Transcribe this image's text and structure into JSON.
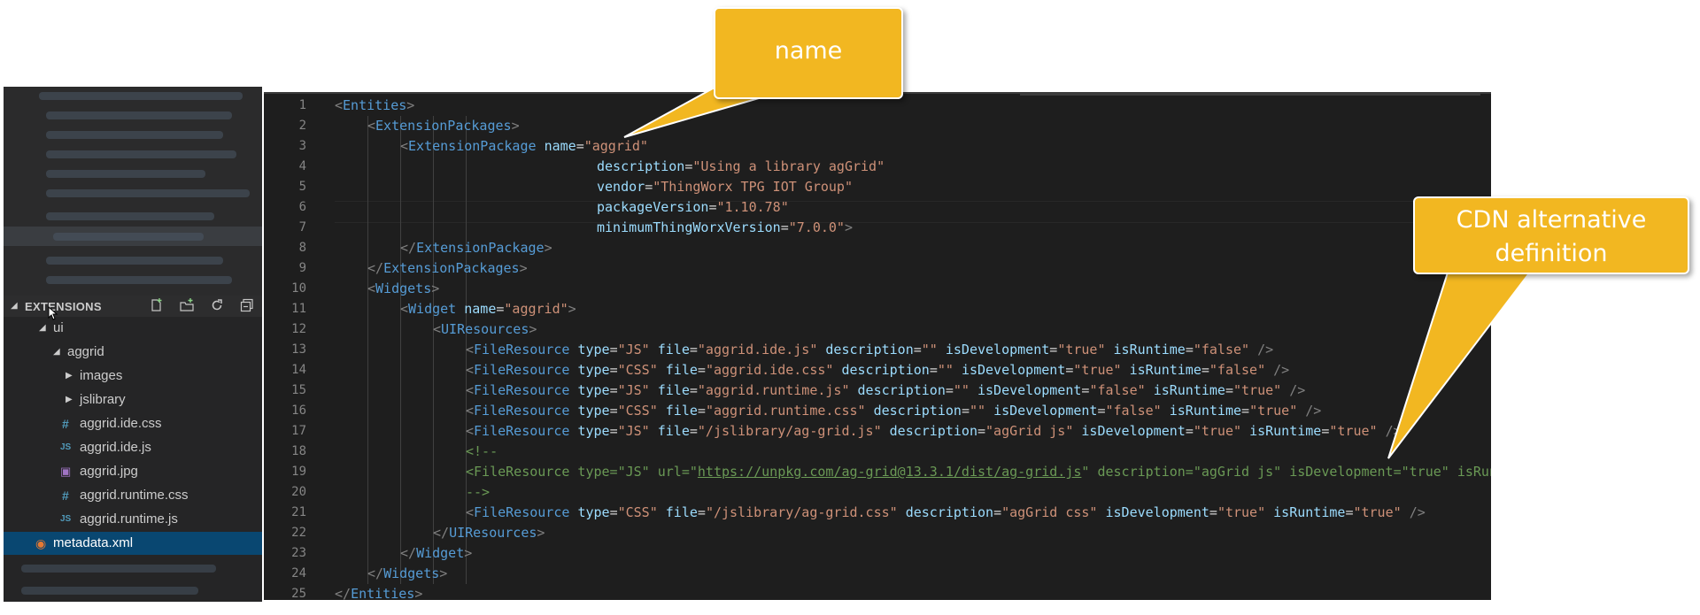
{
  "sidebar": {
    "section_title": "EXTENSIONS",
    "tree": [
      {
        "label": "ui",
        "icon": "chevron-down-icon"
      },
      {
        "label": "aggrid",
        "icon": "chevron-down-icon"
      },
      {
        "label": "images",
        "icon": "chevron-right-icon"
      },
      {
        "label": "jslibrary",
        "icon": "chevron-right-icon"
      },
      {
        "label": "aggrid.ide.css",
        "icon": "css-file-icon"
      },
      {
        "label": "aggrid.ide.js",
        "icon": "js-file-icon"
      },
      {
        "label": "aggrid.jpg",
        "icon": "image-file-icon"
      },
      {
        "label": "aggrid.runtime.css",
        "icon": "css-file-icon"
      },
      {
        "label": "aggrid.runtime.js",
        "icon": "js-file-icon"
      },
      {
        "label": "metadata.xml",
        "icon": "xml-rss-icon",
        "selected": true
      }
    ],
    "icon_glyphs": {
      "css": "#",
      "js": "JS",
      "img": "▣",
      "rss": "◉"
    }
  },
  "toolbar": {
    "icons": [
      "new-file-icon",
      "new-folder-icon",
      "refresh-icon",
      "collapse-all-icon"
    ]
  },
  "editor": {
    "line_numbers": [
      "1",
      "2",
      "3",
      "4",
      "5",
      "6",
      "7",
      "8",
      "9",
      "10",
      "11",
      "12",
      "13",
      "14",
      "15",
      "16",
      "17",
      "18",
      "19",
      "20",
      "21",
      "22",
      "23",
      "24",
      "25"
    ],
    "lines": [
      [
        [
          "b",
          "<"
        ],
        [
          "t",
          "Entities"
        ],
        [
          "b",
          ">"
        ]
      ],
      [
        [
          "b",
          "<"
        ],
        [
          "t",
          "ExtensionPackages"
        ],
        [
          "b",
          ">"
        ]
      ],
      [
        [
          "b",
          "<"
        ],
        [
          "t",
          "ExtensionPackage "
        ],
        [
          "a",
          "name"
        ],
        [
          "e",
          "="
        ],
        [
          "v",
          "\"aggrid\""
        ]
      ],
      [
        [
          "a",
          "description"
        ],
        [
          "e",
          "="
        ],
        [
          "v",
          "\"Using a library agGrid\""
        ]
      ],
      [
        [
          "a",
          "vendor"
        ],
        [
          "e",
          "="
        ],
        [
          "v",
          "\"ThingWorx TPG IOT Group\""
        ]
      ],
      [
        [
          "a",
          "packageVersion"
        ],
        [
          "e",
          "="
        ],
        [
          "v",
          "\"1.10.78\""
        ]
      ],
      [
        [
          "a",
          "minimumThingWorxVersion"
        ],
        [
          "e",
          "="
        ],
        [
          "v",
          "\"7.0.0\""
        ],
        [
          "b",
          ">"
        ]
      ],
      [
        [
          "b",
          "</"
        ],
        [
          "t",
          "ExtensionPackage"
        ],
        [
          "b",
          ">"
        ]
      ],
      [
        [
          "b",
          "</"
        ],
        [
          "t",
          "ExtensionPackages"
        ],
        [
          "b",
          ">"
        ]
      ],
      [
        [
          "b",
          "<"
        ],
        [
          "t",
          "Widgets"
        ],
        [
          "b",
          ">"
        ]
      ],
      [
        [
          "b",
          "<"
        ],
        [
          "t",
          "Widget "
        ],
        [
          "a",
          "name"
        ],
        [
          "e",
          "="
        ],
        [
          "v",
          "\"aggrid\""
        ],
        [
          "b",
          ">"
        ]
      ],
      [
        [
          "b",
          "<"
        ],
        [
          "t",
          "UIResources"
        ],
        [
          "b",
          ">"
        ]
      ],
      [
        [
          "b",
          "<"
        ],
        [
          "t",
          "FileResource "
        ],
        [
          "a",
          "type"
        ],
        [
          "e",
          "="
        ],
        [
          "v",
          "\"JS\" "
        ],
        [
          "a",
          "file"
        ],
        [
          "e",
          "="
        ],
        [
          "v",
          "\"aggrid.ide.js\" "
        ],
        [
          "a",
          "description"
        ],
        [
          "e",
          "="
        ],
        [
          "v",
          "\"\" "
        ],
        [
          "a",
          "isDevelopment"
        ],
        [
          "e",
          "="
        ],
        [
          "v",
          "\"true\" "
        ],
        [
          "a",
          "isRuntime"
        ],
        [
          "e",
          "="
        ],
        [
          "v",
          "\"false\" "
        ],
        [
          "b",
          "/>"
        ]
      ],
      [
        [
          "b",
          "<"
        ],
        [
          "t",
          "FileResource "
        ],
        [
          "a",
          "type"
        ],
        [
          "e",
          "="
        ],
        [
          "v",
          "\"CSS\" "
        ],
        [
          "a",
          "file"
        ],
        [
          "e",
          "="
        ],
        [
          "v",
          "\"aggrid.ide.css\" "
        ],
        [
          "a",
          "description"
        ],
        [
          "e",
          "="
        ],
        [
          "v",
          "\"\" "
        ],
        [
          "a",
          "isDevelopment"
        ],
        [
          "e",
          "="
        ],
        [
          "v",
          "\"true\" "
        ],
        [
          "a",
          "isRuntime"
        ],
        [
          "e",
          "="
        ],
        [
          "v",
          "\"false\" "
        ],
        [
          "b",
          "/>"
        ]
      ],
      [
        [
          "b",
          "<"
        ],
        [
          "t",
          "FileResource "
        ],
        [
          "a",
          "type"
        ],
        [
          "e",
          "="
        ],
        [
          "v",
          "\"JS\" "
        ],
        [
          "a",
          "file"
        ],
        [
          "e",
          "="
        ],
        [
          "v",
          "\"aggrid.runtime.js\" "
        ],
        [
          "a",
          "description"
        ],
        [
          "e",
          "="
        ],
        [
          "v",
          "\"\" "
        ],
        [
          "a",
          "isDevelopment"
        ],
        [
          "e",
          "="
        ],
        [
          "v",
          "\"false\" "
        ],
        [
          "a",
          "isRuntime"
        ],
        [
          "e",
          "="
        ],
        [
          "v",
          "\"true\" "
        ],
        [
          "b",
          "/>"
        ]
      ],
      [
        [
          "b",
          "<"
        ],
        [
          "t",
          "FileResource "
        ],
        [
          "a",
          "type"
        ],
        [
          "e",
          "="
        ],
        [
          "v",
          "\"CSS\" "
        ],
        [
          "a",
          "file"
        ],
        [
          "e",
          "="
        ],
        [
          "v",
          "\"aggrid.runtime.css\" "
        ],
        [
          "a",
          "description"
        ],
        [
          "e",
          "="
        ],
        [
          "v",
          "\"\" "
        ],
        [
          "a",
          "isDevelopment"
        ],
        [
          "e",
          "="
        ],
        [
          "v",
          "\"false\" "
        ],
        [
          "a",
          "isRuntime"
        ],
        [
          "e",
          "="
        ],
        [
          "v",
          "\"true\" "
        ],
        [
          "b",
          "/>"
        ]
      ],
      [
        [
          "b",
          "<"
        ],
        [
          "t",
          "FileResource "
        ],
        [
          "a",
          "type"
        ],
        [
          "e",
          "="
        ],
        [
          "v",
          "\"JS\" "
        ],
        [
          "a",
          "file"
        ],
        [
          "e",
          "="
        ],
        [
          "v",
          "\"/jslibrary/ag-grid.js\" "
        ],
        [
          "a",
          "description"
        ],
        [
          "e",
          "="
        ],
        [
          "v",
          "\"agGrid js\" "
        ],
        [
          "a",
          "isDevelopment"
        ],
        [
          "e",
          "="
        ],
        [
          "v",
          "\"true\" "
        ],
        [
          "a",
          "isRuntime"
        ],
        [
          "e",
          "="
        ],
        [
          "v",
          "\"tr"
        ],
        [
          "v",
          "ue\" "
        ],
        [
          "b",
          "/>"
        ]
      ],
      [
        [
          "c",
          "<!--"
        ]
      ],
      [
        [
          "c",
          "<FileResource type=\"JS\" url=\""
        ],
        [
          "l",
          "https://unpkg.com/ag-grid@13.3.1/dist/ag-grid.js"
        ],
        [
          "c",
          "\" description=\"agGrid js\" isDevelopment=\"true\" isRuntime=\"true\" />"
        ]
      ],
      [
        [
          "c",
          "-->"
        ]
      ],
      [
        [
          "b",
          "<"
        ],
        [
          "t",
          "FileResource "
        ],
        [
          "a",
          "type"
        ],
        [
          "e",
          "="
        ],
        [
          "v",
          "\"CSS\" "
        ],
        [
          "a",
          "file"
        ],
        [
          "e",
          "="
        ],
        [
          "v",
          "\"/jslibrary/ag-grid.css\" "
        ],
        [
          "a",
          "description"
        ],
        [
          "e",
          "="
        ],
        [
          "v",
          "\"agGrid css\" "
        ],
        [
          "a",
          "isDevelopment"
        ],
        [
          "e",
          "="
        ],
        [
          "v",
          "\"true\" "
        ],
        [
          "a",
          "isRuntime"
        ],
        [
          "e",
          "="
        ],
        [
          "v",
          "\"true\" "
        ],
        [
          "b",
          "/>"
        ]
      ],
      [
        [
          "b",
          "</"
        ],
        [
          "t",
          "UIResources"
        ],
        [
          "b",
          ">"
        ]
      ],
      [
        [
          "b",
          "</"
        ],
        [
          "t",
          "Widget"
        ],
        [
          "b",
          ">"
        ]
      ],
      [
        [
          "b",
          "</"
        ],
        [
          "t",
          "Widgets"
        ],
        [
          "b",
          ">"
        ]
      ],
      [
        [
          "b",
          "</"
        ],
        [
          "t",
          "Entities"
        ],
        [
          "b",
          ">"
        ]
      ]
    ]
  },
  "callouts": {
    "name": "name",
    "cdn_line1": "CDN alternative",
    "cdn_line2": "definition"
  },
  "colors": {
    "callout": "#f2b721",
    "editor_bg": "#1e1e1e",
    "sidebar_bg": "#252526",
    "selection": "#094771"
  }
}
